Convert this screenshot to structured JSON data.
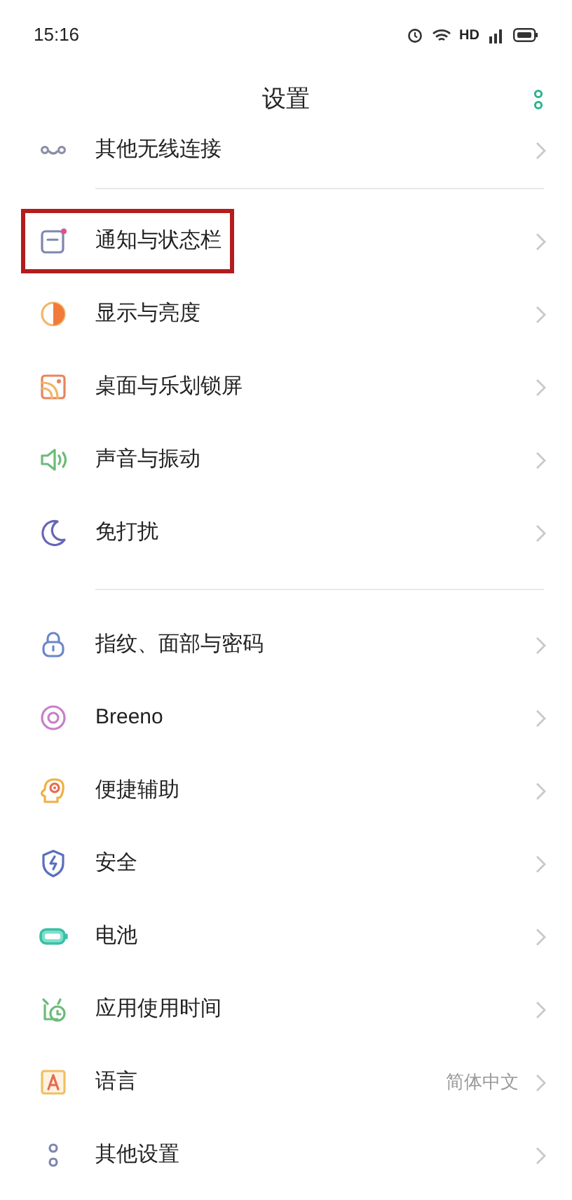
{
  "status_bar": {
    "time": "15:16",
    "network": "HD"
  },
  "header": {
    "title": "设置"
  },
  "sections": [
    {
      "items": [
        {
          "label": "其他无线连接",
          "highlighted": false
        }
      ]
    },
    {
      "items": [
        {
          "label": "通知与状态栏",
          "highlighted": true
        },
        {
          "label": "显示与亮度",
          "highlighted": false
        },
        {
          "label": "桌面与乐划锁屏",
          "highlighted": false
        },
        {
          "label": "声音与振动",
          "highlighted": false
        },
        {
          "label": "免打扰",
          "highlighted": false
        }
      ]
    },
    {
      "items": [
        {
          "label": "指纹、面部与密码",
          "highlighted": false
        },
        {
          "label": "Breeno",
          "highlighted": false
        },
        {
          "label": "便捷辅助",
          "highlighted": false
        },
        {
          "label": "安全",
          "highlighted": false
        },
        {
          "label": "电池",
          "highlighted": false
        },
        {
          "label": "应用使用时间",
          "highlighted": false
        },
        {
          "label": "语言",
          "value": "简体中文",
          "highlighted": false
        },
        {
          "label": "其他设置",
          "highlighted": false
        }
      ]
    }
  ]
}
